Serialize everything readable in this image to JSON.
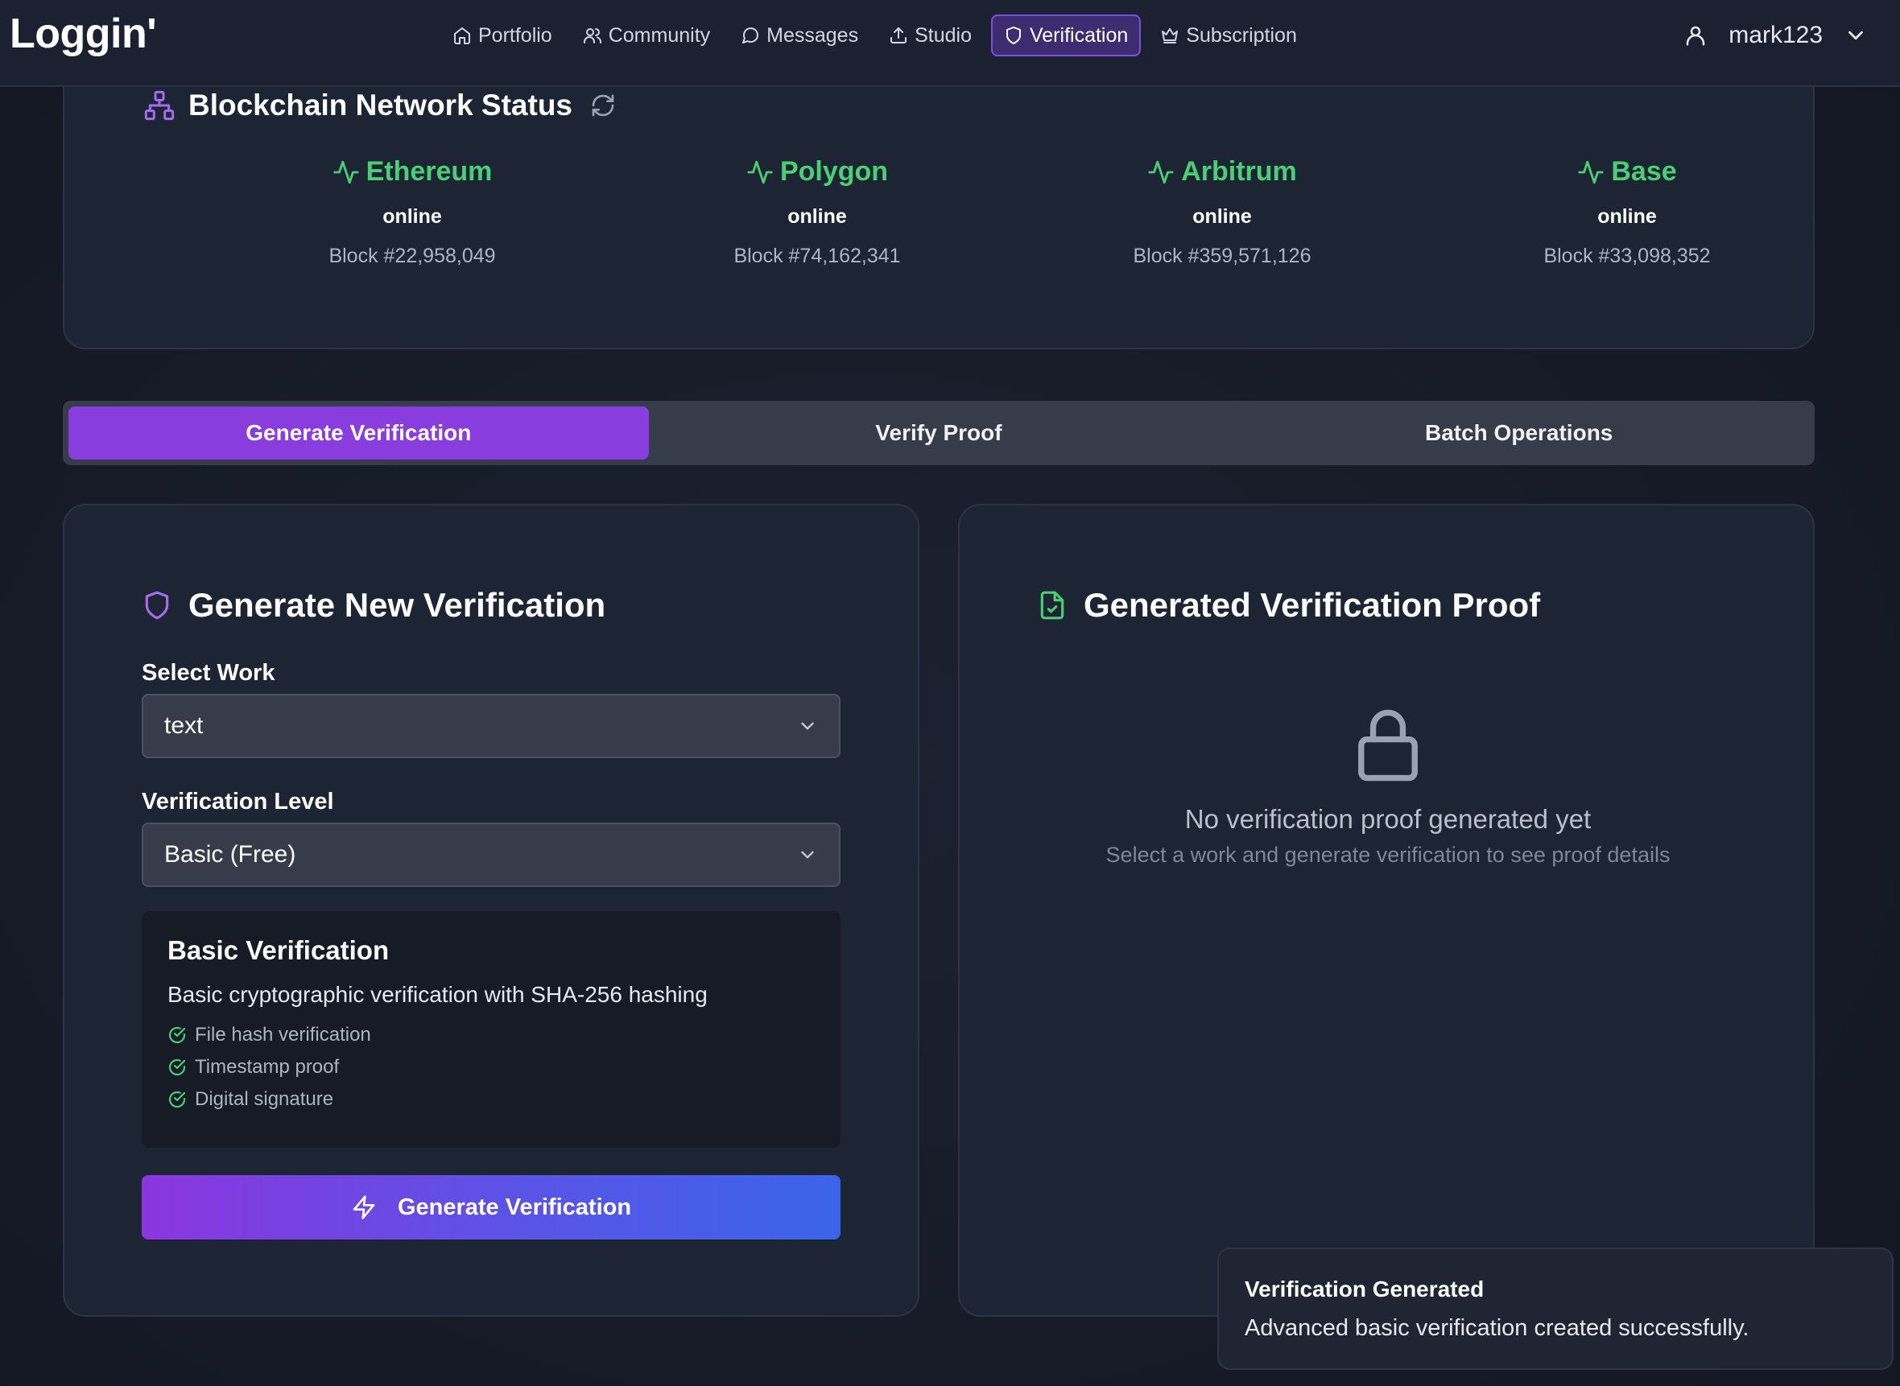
{
  "app": {
    "logo": "Loggin'"
  },
  "nav": {
    "items": [
      {
        "label": "Portfolio",
        "icon": "home-icon"
      },
      {
        "label": "Community",
        "icon": "users-icon"
      },
      {
        "label": "Messages",
        "icon": "message-circle-icon"
      },
      {
        "label": "Studio",
        "icon": "upload-icon"
      },
      {
        "label": "Verification",
        "icon": "shield-icon",
        "active": true
      },
      {
        "label": "Subscription",
        "icon": "crown-icon"
      }
    ]
  },
  "user": {
    "name": "mark123"
  },
  "network": {
    "title": "Blockchain Network Status",
    "chains": [
      {
        "name": "Ethereum",
        "status": "online",
        "block": "Block #22,958,049"
      },
      {
        "name": "Polygon",
        "status": "online",
        "block": "Block #74,162,341"
      },
      {
        "name": "Arbitrum",
        "status": "online",
        "block": "Block #359,571,126"
      },
      {
        "name": "Base",
        "status": "online",
        "block": "Block #33,098,352"
      }
    ],
    "status_color": "#4ccf74"
  },
  "tabs": [
    {
      "label": "Generate Verification",
      "active": true
    },
    {
      "label": "Verify Proof"
    },
    {
      "label": "Batch Operations"
    }
  ],
  "generate": {
    "title": "Generate New Verification",
    "work_label": "Select Work",
    "work_value": "text",
    "level_label": "Verification Level",
    "level_value": "Basic (Free)",
    "info": {
      "title": "Basic Verification",
      "description": "Basic cryptographic verification with SHA-256 hashing",
      "features": [
        "File hash verification",
        "Timestamp proof",
        "Digital signature"
      ]
    },
    "button_label": "Generate Verification"
  },
  "proof": {
    "title": "Generated Verification Proof",
    "empty_title": "No verification proof generated yet",
    "empty_subtitle": "Select a work and generate verification to see proof details"
  },
  "toast": {
    "title": "Verification Generated",
    "message": "Advanced basic verification created successfully."
  },
  "colors": {
    "accent": "#8a3ddf",
    "success": "#4ccf74",
    "background": "#161b27"
  }
}
